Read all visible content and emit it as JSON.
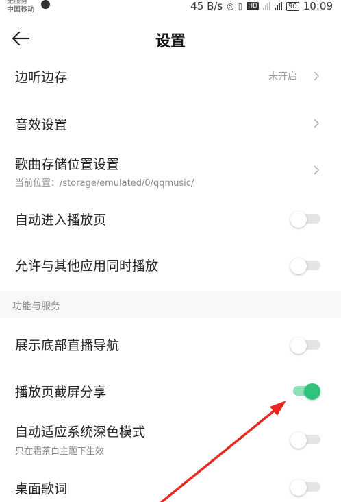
{
  "status_bar": {
    "carrier_line1": "无服务",
    "carrier_line2": "中国移动",
    "speed": "45 B/s",
    "network": "HD",
    "signal_label": "4G",
    "battery": "90",
    "time": "10:09"
  },
  "header": {
    "title": "设置"
  },
  "settings": {
    "listen_save": {
      "label": "边听边存",
      "value": "未开启"
    },
    "sound_effect": {
      "label": "音效设置"
    },
    "storage": {
      "label": "歌曲存储位置设置",
      "sub": "当前位置：/storage/emulated/0/qqmusic/"
    },
    "auto_play_page": {
      "label": "自动进入播放页",
      "on": false
    },
    "simultaneous": {
      "label": "允许与其他应用同时播放",
      "on": false
    }
  },
  "section_services": {
    "title": "功能与服务",
    "items": {
      "bottom_live_nav": {
        "label": "展示底部直播导航",
        "on": false
      },
      "screenshot_share": {
        "label": "播放页截屏分享",
        "on": true
      },
      "dark_mode": {
        "label": "自动适应系统深色模式",
        "sub": "只在霜茶白主题下生效",
        "on": false
      },
      "desktop_lyrics": {
        "label": "桌面歌词",
        "on": false
      }
    }
  },
  "colors": {
    "accent": "#31c27c",
    "annotation_arrow": "#e8281e"
  }
}
